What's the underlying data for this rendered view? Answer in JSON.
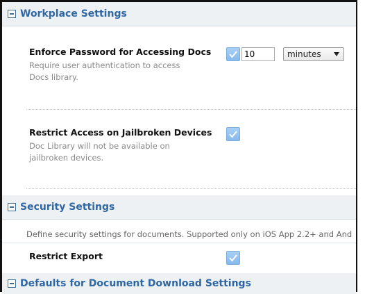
{
  "workplace": {
    "title": "Workplace Settings",
    "enforce_password": {
      "label": "Enforce Password for Accessing Docs",
      "description": "Require user authentication to access Docs library.",
      "checked": true,
      "timeout_value": "10",
      "timeout_unit": "minutes"
    },
    "jailbroken": {
      "label": "Restrict Access on Jailbroken Devices",
      "description": "Doc Library will not be available on jailbroken devices.",
      "checked": true
    }
  },
  "security": {
    "title": "Security Settings",
    "info": "Define security settings for documents. Supported only on iOS App 2.2+ and And",
    "restrict_export": {
      "label": "Restrict Export",
      "checked": true
    }
  },
  "defaults": {
    "title": "Defaults for Document Download Settings"
  },
  "colors": {
    "section_title": "#2f67a5",
    "checkbox": "#8fc0ef"
  }
}
